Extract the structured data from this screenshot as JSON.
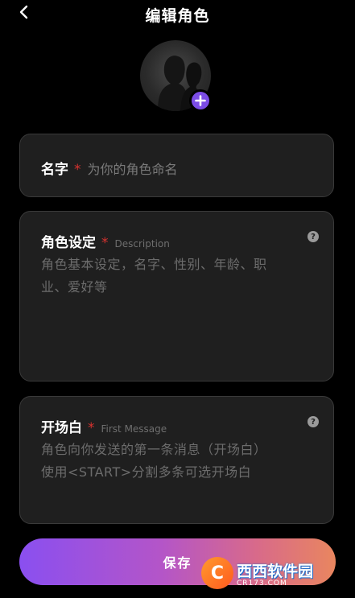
{
  "header": {
    "title": "编辑角色"
  },
  "avatar": {
    "add_symbol": "+"
  },
  "name_field": {
    "label": "名字",
    "required_mark": "*",
    "placeholder": "为你的角色命名"
  },
  "setting_field": {
    "label": "角色设定",
    "required_mark": "*",
    "sub_label": "Description",
    "placeholder_line1": "角色基本设定，名字、性别、年龄、职",
    "placeholder_line2": "业、爱好等",
    "help_symbol": "?"
  },
  "opening_field": {
    "label": "开场白",
    "required_mark": "*",
    "sub_label": "First Message",
    "placeholder_line1": "角色向你发送的第一条消息（开场白）",
    "placeholder_line2": "使用<START>分割多条可选开场白",
    "help_symbol": "?"
  },
  "save_button": {
    "label": "保存"
  },
  "watermark": {
    "mark": "C",
    "text": "西西软件园",
    "domain": "CR173.COM"
  }
}
